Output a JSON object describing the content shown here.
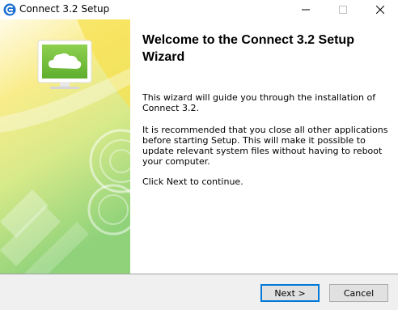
{
  "window": {
    "title": "Connect 3.2 Setup",
    "minimize_glyph": "—",
    "maximize_glyph": "☐",
    "close_glyph": "✕"
  },
  "main": {
    "heading": "Welcome to the Connect 3.2 Setup Wizard",
    "paragraph_intro": "This wizard will guide you through the installation of Connect 3.2.",
    "paragraph_recommend": "It is recommended that you close all other applications before starting Setup. This will make it possible to update relevant system files without having to reboot your computer.",
    "paragraph_continue": "Click Next to continue."
  },
  "footer": {
    "next_label": "Next >",
    "cancel_label": "Cancel"
  },
  "icons": {
    "app": "connect-logo-icon",
    "banner": "monitor-cloud-icon"
  },
  "colors": {
    "accent": "#0078d7",
    "banner_yellow": "#f7e45a",
    "banner_green": "#9bd37a",
    "monitor_green": "#7dc142"
  }
}
